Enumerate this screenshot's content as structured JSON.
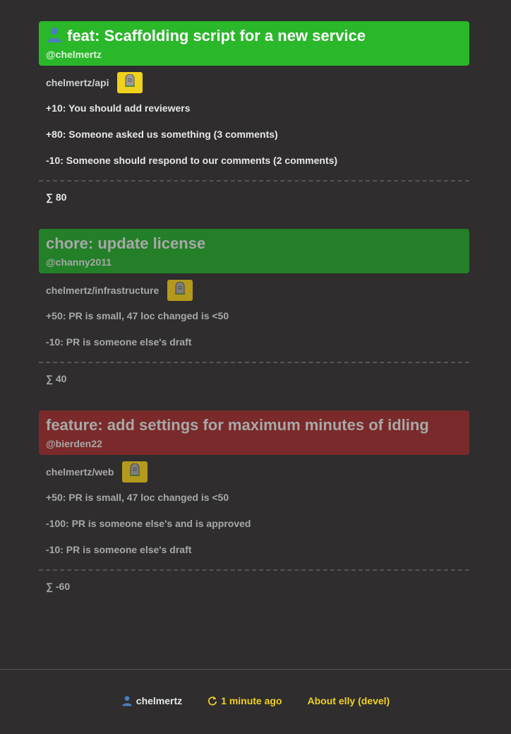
{
  "colors": {
    "background": "#2f2d2e",
    "green": "#2ab72a",
    "green_dim": "#237f28",
    "red": "#7a2a2a",
    "accent": "#f0d21c"
  },
  "prs": [
    {
      "title": "feat: Scaffolding script for a new service",
      "author": "@chelmertz",
      "repo": "chelmertz/api",
      "status": "green",
      "icon": "person-icon",
      "button_icon": "gravestone-icon",
      "reasons": [
        "+10: You should add reviewers",
        "+80: Someone asked us something (3 comments)",
        "-10: Someone should respond to our comments (2 comments)"
      ],
      "sum": "∑ 80"
    },
    {
      "title": "chore: update license",
      "author": "@channy2011",
      "repo": "chelmertz/infrastructure",
      "status": "green-dim",
      "button_icon": "gravestone-icon",
      "reasons": [
        "+50: PR is small, 47 loc changed is <50",
        "-10: PR is someone else's draft"
      ],
      "sum": "∑ 40"
    },
    {
      "title": "feature: add settings for maximum minutes of idling",
      "author": "@bierden22",
      "repo": "chelmertz/web",
      "status": "red",
      "button_icon": "gravestone-icon",
      "reasons": [
        "+50: PR is small, 47 loc changed is <50",
        "-100: PR is someone else's and is approved",
        "-10: PR is someone else's draft"
      ],
      "sum": "∑ -60"
    }
  ],
  "footer": {
    "user": "chelmertz",
    "user_icon": "person-icon",
    "refresh": "1 minute ago",
    "refresh_icon": "refresh-icon",
    "about": "About elly (devel)"
  }
}
